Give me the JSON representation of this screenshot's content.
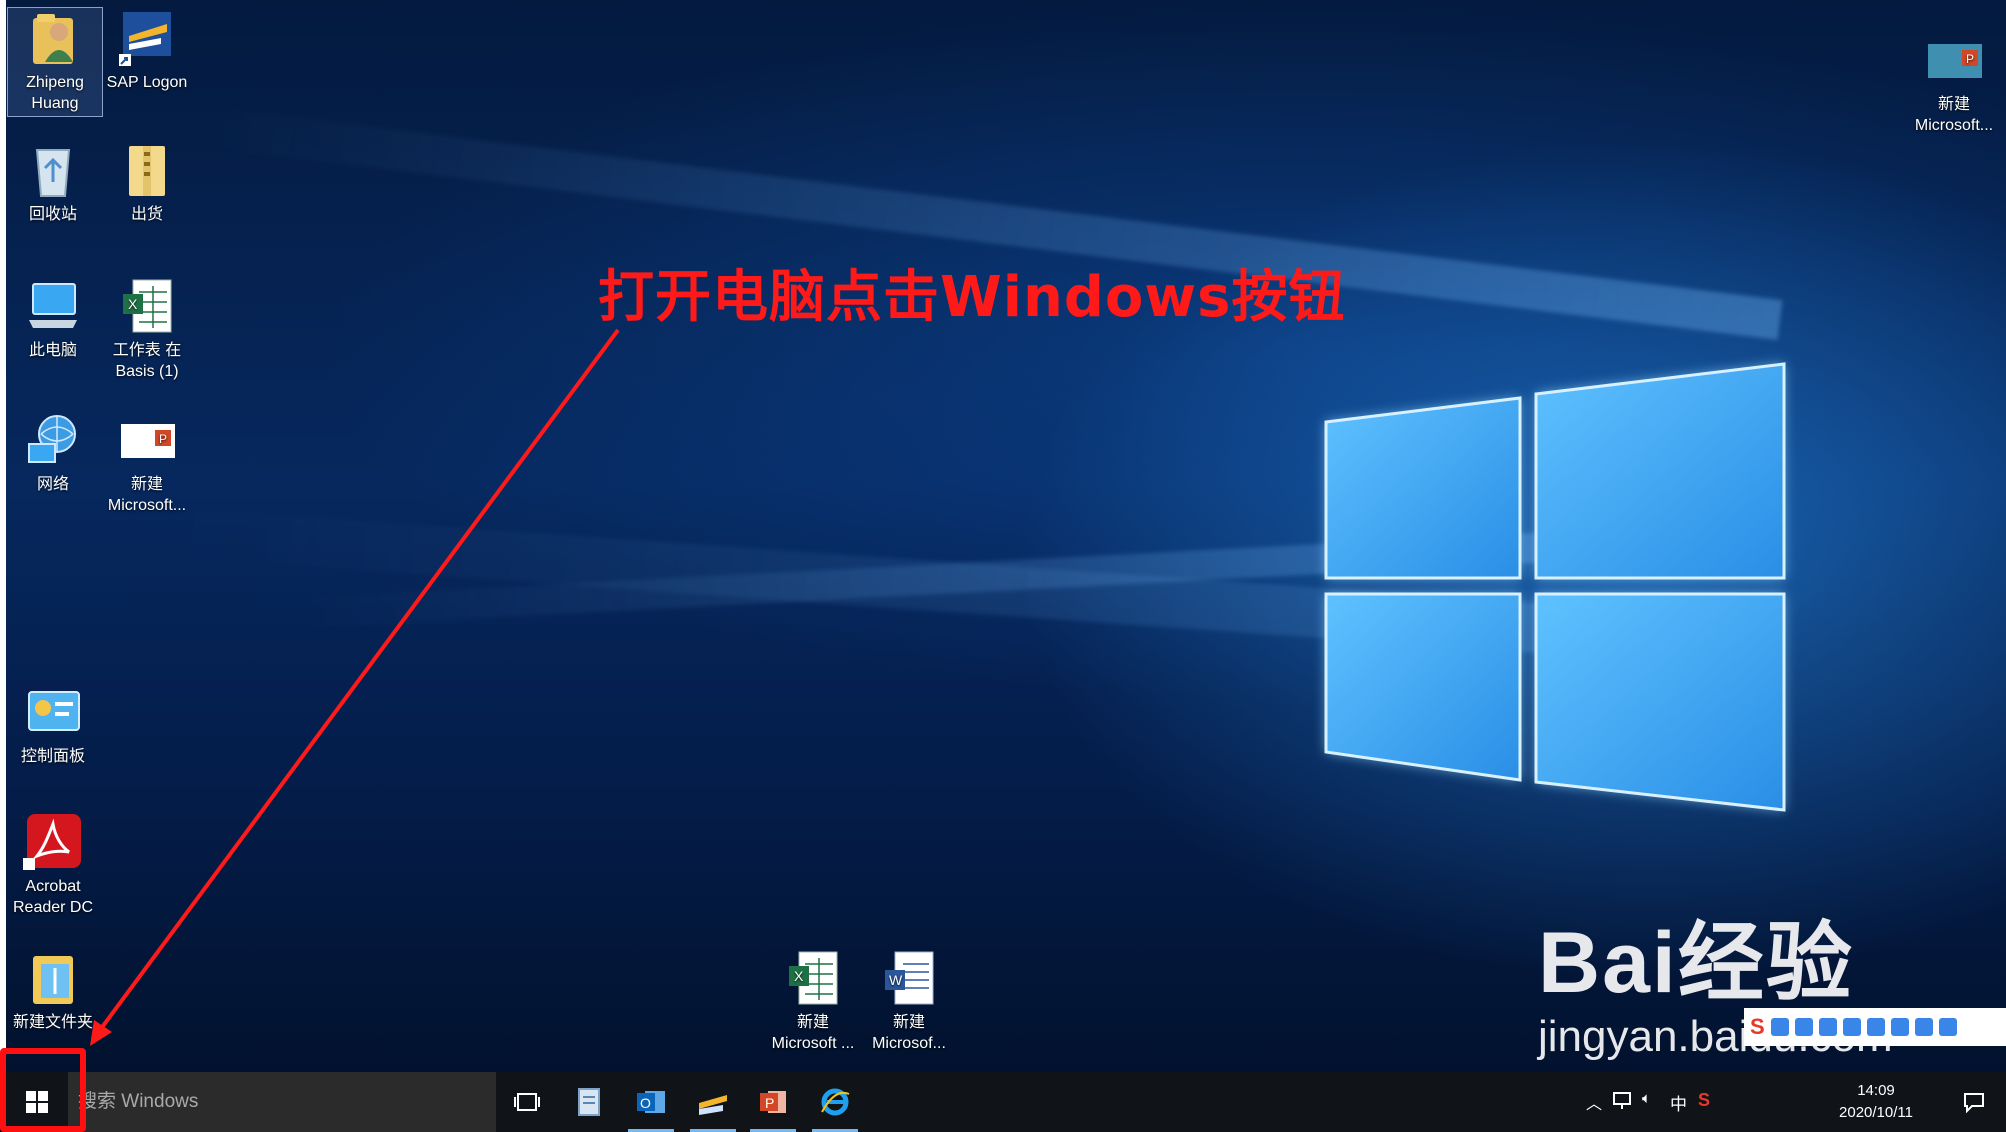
{
  "desktop": {
    "icons": [
      {
        "label": "Zhipeng\nHuang"
      },
      {
        "label": "SAP Logon"
      },
      {
        "label": "回收站"
      },
      {
        "label": "出货"
      },
      {
        "label": "此电脑"
      },
      {
        "label": "工作表 在\nBasis (1)"
      },
      {
        "label": "网络"
      },
      {
        "label": "新建\nMicrosoft..."
      },
      {
        "label": "控制面板"
      },
      {
        "label": "Acrobat\nReader DC"
      },
      {
        "label": "新建文件夹"
      },
      {
        "label": "新建\nMicrosoft ..."
      },
      {
        "label": "新建\nMicrosof..."
      },
      {
        "label": "新建\nMicrosoft..."
      }
    ]
  },
  "annotation": {
    "text": "打开电脑点击Windows按钮",
    "color": "#ff1a1a"
  },
  "taskbar": {
    "search_placeholder": "搜索 Windows",
    "tray": {
      "ime_lang": "中",
      "time": "14:09",
      "date": "2020/10/11"
    }
  },
  "watermark": {
    "logo": "Bai经验",
    "url": "jingyan.baidu.com"
  },
  "colors": {
    "accent": "#77b7f2",
    "highlight": "#ff1010",
    "taskbar": "#101418"
  }
}
